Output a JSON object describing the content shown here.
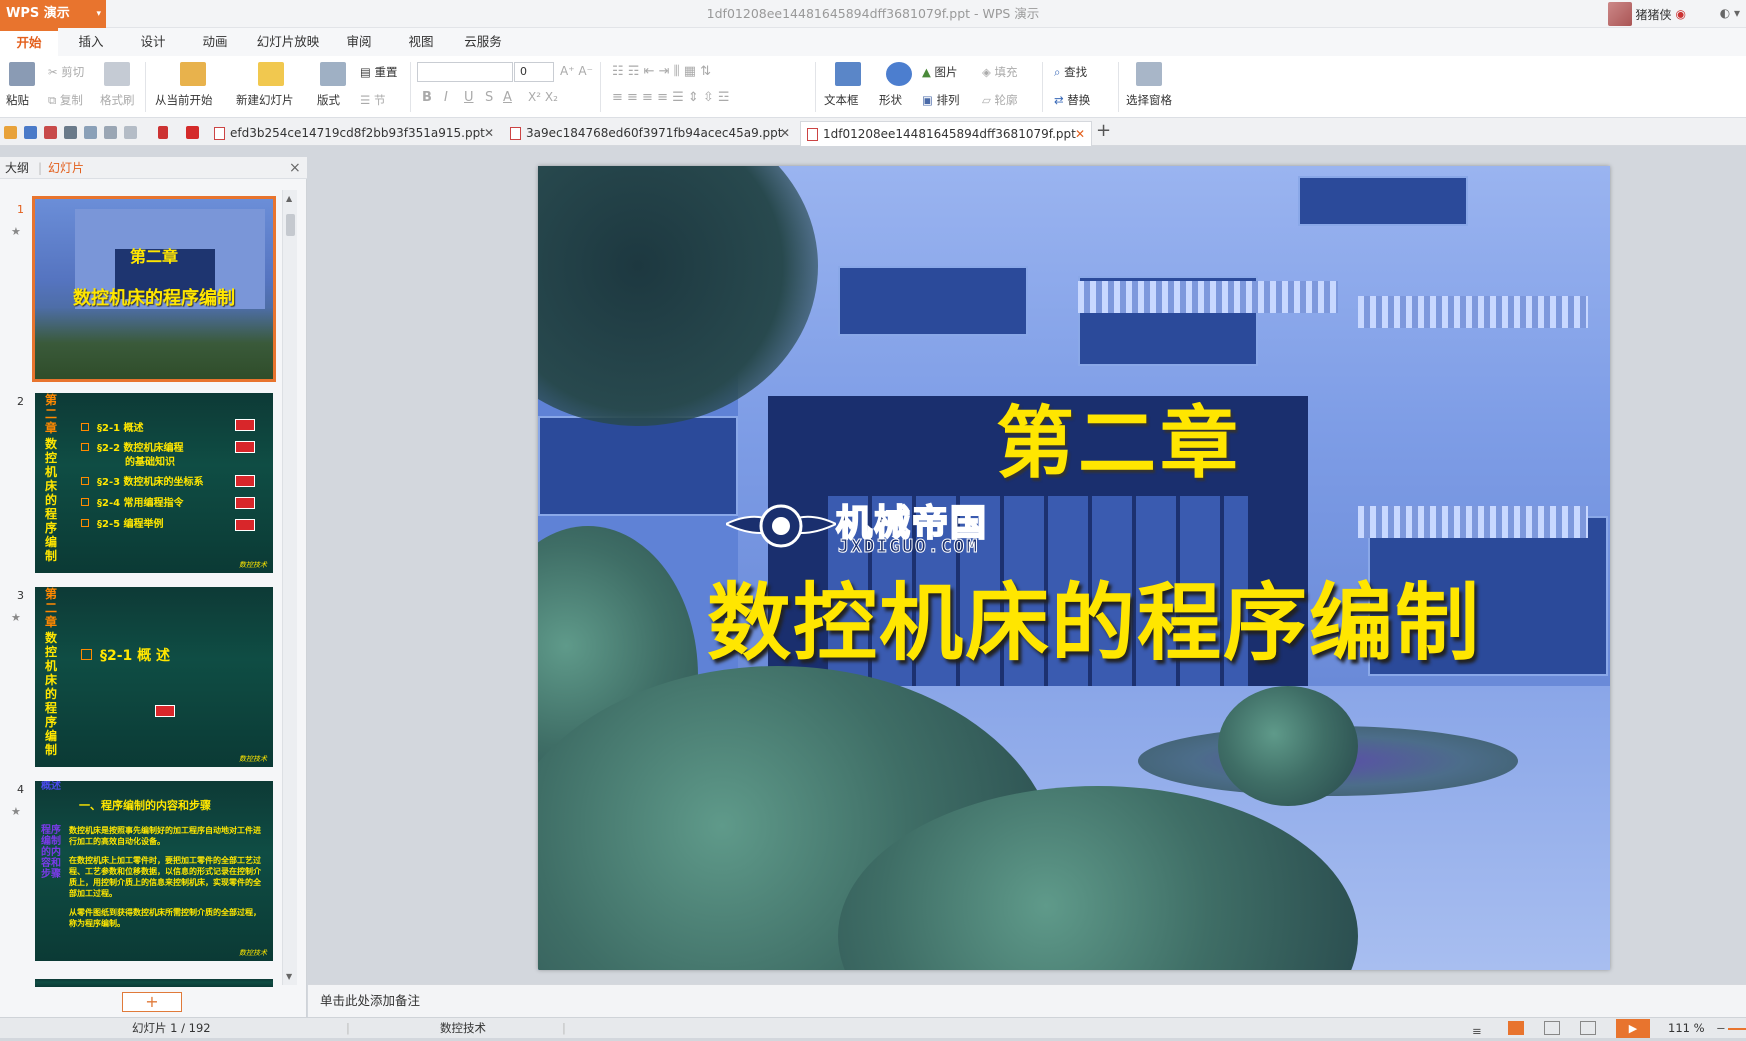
{
  "app": {
    "name": "WPS 演示",
    "window_title": "1df01208ee14481645894dff3681079f.ppt - WPS 演示",
    "user_name": "猪猪侠"
  },
  "ribbon_tabs": [
    "开始",
    "插入",
    "设计",
    "动画",
    "幻灯片放映",
    "审阅",
    "视图",
    "云服务"
  ],
  "ribbon": {
    "paste": "粘贴",
    "cut": "剪切",
    "copy": "复制",
    "format_painter": "格式刷",
    "from_current": "从当前开始",
    "new_slide": "新建幻灯片",
    "layout": "版式",
    "reset": "重置",
    "section": "节",
    "font_size": "0",
    "bold": "B",
    "italic": "I",
    "underline": "U",
    "strike": "S",
    "font_color": "A",
    "textbox": "文本框",
    "shape": "形状",
    "picture": "图片",
    "fill": "填充",
    "arrange": "排列",
    "outline": "轮廓",
    "find": "查找",
    "replace": "替换",
    "selection_pane": "选择窗格"
  },
  "doc_tabs": [
    {
      "name": "efd3b254ce14719cd8f2bb93f351a915.ppt"
    },
    {
      "name": "3a9ec184768ed60f3971fb94acec45a9.ppt"
    },
    {
      "name": "1df01208ee14481645894dff3681079f.ppt"
    }
  ],
  "panel": {
    "tab_outline": "大纲",
    "tab_slides": "幻灯片",
    "close": "×"
  },
  "thumbs": {
    "s1_title": "第二章",
    "s1_subtitle": "数控机床的程序编制",
    "side_title_top": "第二章",
    "side_title": "数控机床的程序编制",
    "s2_items": [
      "§2-1  概述",
      "§2-2  数控机床编程",
      "的基础知识",
      "§2-3  数控机床的坐标系",
      "§2-4  常用编程指令",
      "§2-5  编程举例"
    ],
    "footer": "数控技术",
    "s3_item": "§2-1  概  述",
    "s4_side_top": "概述",
    "s4_side": "程序编制的内容和步骤",
    "s4_heading": "一、程序编制的内容和步骤",
    "s4_paragraphs": [
      "数控机床是按照事先编制好的加工程序自动地对工件进行加工的高效自动化设备。",
      "在数控机床上加工零件时，要把加工零件的全部工艺过程、工艺参数和位移数据，以信息的形式记录在控制介质上，用控制介质上的信息来控制机床，实现零件的全部加工过程。",
      "从零件图纸到获得数控机床所需控制介质的全部过程，称为程序编制。"
    ]
  },
  "slide": {
    "title": "第二章",
    "subtitle": "数控机床的程序编制",
    "watermark": "机械帝国",
    "watermark_url": "JXDIGUO.COM"
  },
  "notes_placeholder": "单击此处添加备注",
  "status": {
    "slide_index": "幻灯片 1 / 192",
    "theme": "数控技术",
    "zoom": "111 %"
  }
}
